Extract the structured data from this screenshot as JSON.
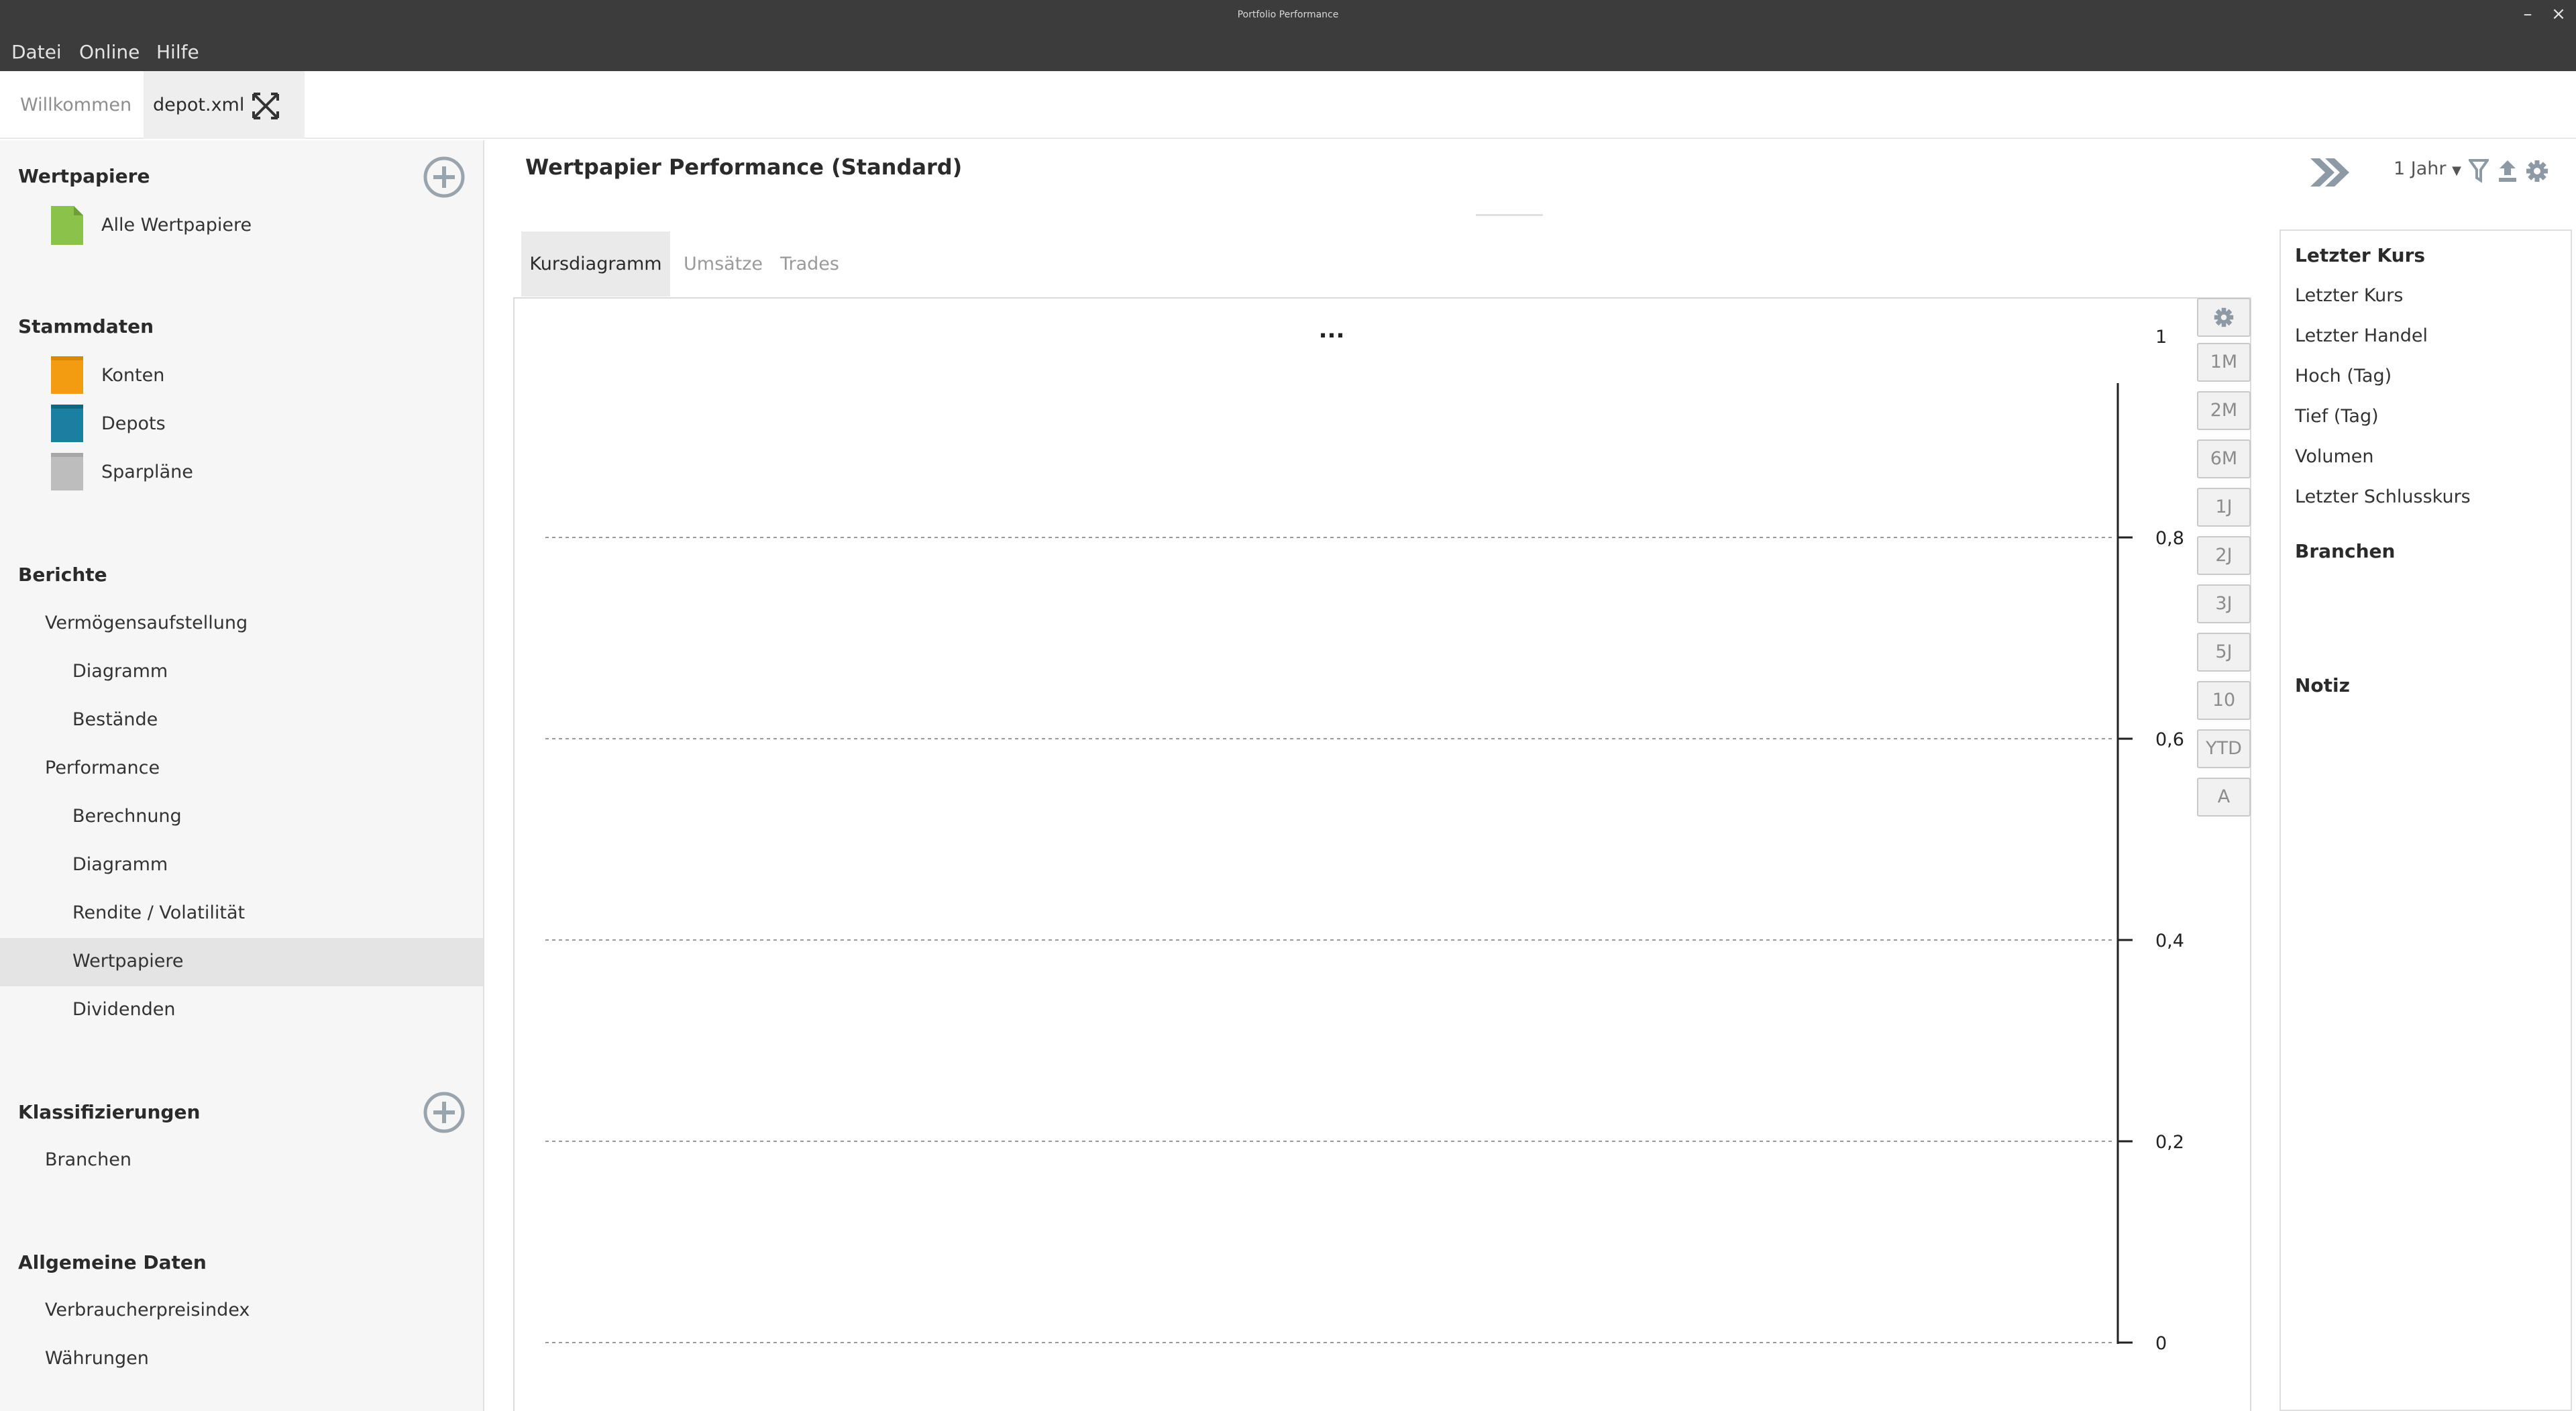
{
  "window": {
    "title": "Portfolio Performance"
  },
  "menu": [
    "Datei",
    "Online",
    "Hilfe"
  ],
  "editor_tabs": [
    {
      "label": "Willkommen"
    },
    {
      "label": "depot.xml"
    }
  ],
  "sidebar": {
    "wertpapiere": {
      "heading": "Wertpapiere",
      "items": [
        "Alle Wertpapiere"
      ]
    },
    "stammdaten": {
      "heading": "Stammdaten",
      "items": [
        "Konten",
        "Depots",
        "Sparpläne"
      ]
    },
    "berichte": {
      "heading": "Berichte",
      "items": [
        "Vermögensaufstellung",
        "Diagramm",
        "Bestände",
        "Performance",
        "Berechnung",
        "Diagramm",
        "Rendite / Volatilität",
        "Wertpapiere",
        "Dividenden"
      ],
      "selected": "Wertpapiere"
    },
    "klassifizierungen": {
      "heading": "Klassifizierungen",
      "items": [
        "Branchen"
      ]
    },
    "allgemein": {
      "heading": "Allgemeine Daten",
      "items": [
        "Verbraucherpreisindex",
        "Währungen"
      ]
    }
  },
  "page": {
    "title": "Wertpapier Performance (Standard)",
    "period": "1 Jahr",
    "tabs": [
      "Kursdiagramm",
      "Umsätze",
      "Trades"
    ],
    "active_tab": "Kursdiagramm"
  },
  "chart_controls": [
    "1M",
    "2M",
    "6M",
    "1J",
    "2J",
    "3J",
    "5J",
    "10",
    "YTD",
    "A"
  ],
  "chart_data": {
    "type": "line",
    "title": "...",
    "ylim": [
      0,
      1
    ],
    "yticks": [
      "1",
      "0,8",
      "0,6",
      "0,4",
      "0,2",
      "0"
    ],
    "ytick_values": [
      1,
      0.8,
      0.6,
      0.4,
      0.2,
      0
    ],
    "grid": true,
    "series": []
  },
  "info_panel": {
    "heading": "Letzter Kurs",
    "items": [
      "Letzter Kurs",
      "Letzter Handel",
      "Hoch (Tag)",
      "Tief (Tag)",
      "Volumen",
      "Letzter Schlusskurs"
    ],
    "branchen_heading": "Branchen",
    "notiz_heading": "Notiz"
  },
  "colors": {
    "titlebar": "#3c3c3c",
    "konten_icon": "#f39c12",
    "depots_icon": "#1a7fa0",
    "sparplaene_icon": "#bdbdbd",
    "wertpapiere_icon": "#8bc34a",
    "add_icon": "#9aa4ad"
  }
}
